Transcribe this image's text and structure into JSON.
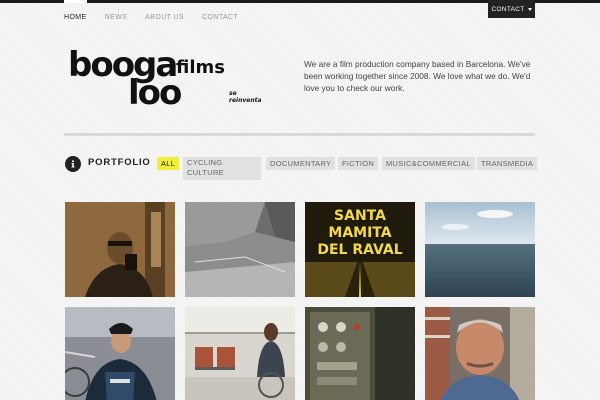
{
  "nav": {
    "items": [
      {
        "label": "HOME",
        "active": true
      },
      {
        "label": "NEWS",
        "active": false
      },
      {
        "label": "ABOUT US",
        "active": false
      },
      {
        "label": "CONTACT",
        "active": false
      }
    ],
    "contact_button": "CONTACT"
  },
  "logo": {
    "wordmark_top": "booga",
    "wordmark_films": "films",
    "wordmark_bottom": "loo",
    "tagline_1": "se",
    "tagline_2": "reinventa"
  },
  "intro": "We are a film production company based in Barcelona. We've been working together since 2008. We love what we do. We'd love you to check our work.",
  "portfolio": {
    "title": "PORTFOLIO",
    "icon": "info-icon",
    "filters": [
      {
        "label": "ALL",
        "active": true
      },
      {
        "label": "CYCLING CULTURE",
        "active": false
      },
      {
        "label": "DOCUMENTARY",
        "active": false
      },
      {
        "label": "FICTION",
        "active": false
      },
      {
        "label": "MUSIC&COMMERCIAL",
        "active": false
      },
      {
        "label": "TRANSMEDIA",
        "active": false
      }
    ],
    "poster_text_1": "SANTA",
    "poster_text_2": "MAMITA",
    "poster_text_3": "DEL RAVAL"
  },
  "colors": {
    "accent": "#f2ee3c",
    "dark": "#222222",
    "tag_bg": "#e1e1e1"
  }
}
